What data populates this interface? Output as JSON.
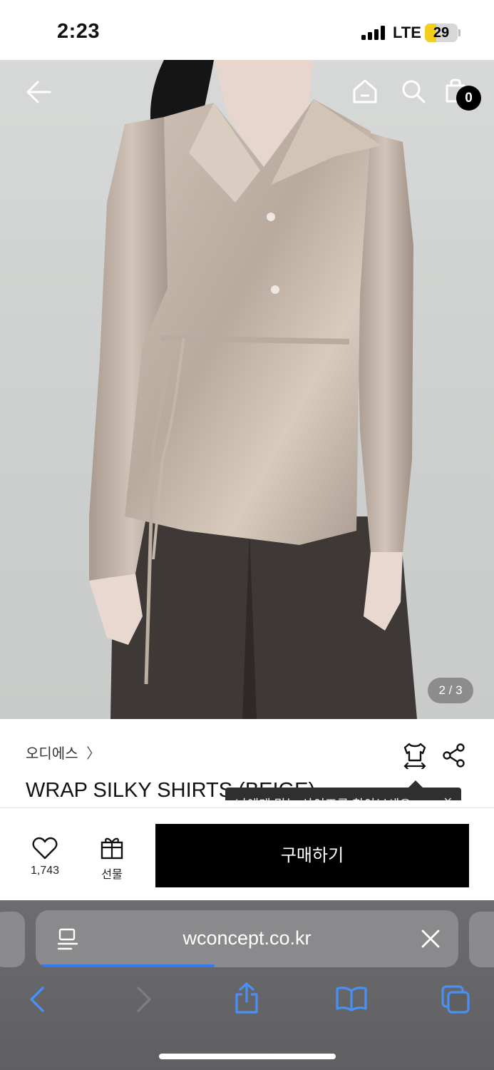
{
  "status_bar": {
    "time": "2:23",
    "network": "LTE",
    "battery": "29",
    "battery_color": "#f2cf1d"
  },
  "top_nav": {
    "back_icon": "arrow-left-icon",
    "home_icon": "home-icon",
    "search_icon": "search-icon",
    "cart_icon": "shopping-bag-icon",
    "cart_count": "0"
  },
  "gallery": {
    "counter": "2 / 3"
  },
  "product": {
    "brand": "오디에스",
    "brand_chevron": "〉",
    "title": "WRAP SILKY SHIRTS (BEIGE)",
    "size_icon": "shirt-size-icon",
    "share_icon": "share-icon"
  },
  "tooltip": {
    "text": "나에게 맞는 사이즈를 찾아보세요",
    "close": "✕"
  },
  "actions": {
    "like_icon": "heart-icon",
    "like_count": "1,743",
    "gift_icon": "gift-icon",
    "gift_label": "선물",
    "buy_label": "구매하기",
    "buy_color": "#000000"
  },
  "browser": {
    "url": "wconcept.co.kr",
    "reader_icon": "reader-icon",
    "clear_icon": "close-icon",
    "back_icon": "chevron-left-icon",
    "forward_icon": "chevron-right-icon",
    "share_icon": "share-up-icon",
    "bookmarks_icon": "book-icon",
    "tabs_icon": "tabs-icon",
    "accent": "#2f7cf6"
  }
}
